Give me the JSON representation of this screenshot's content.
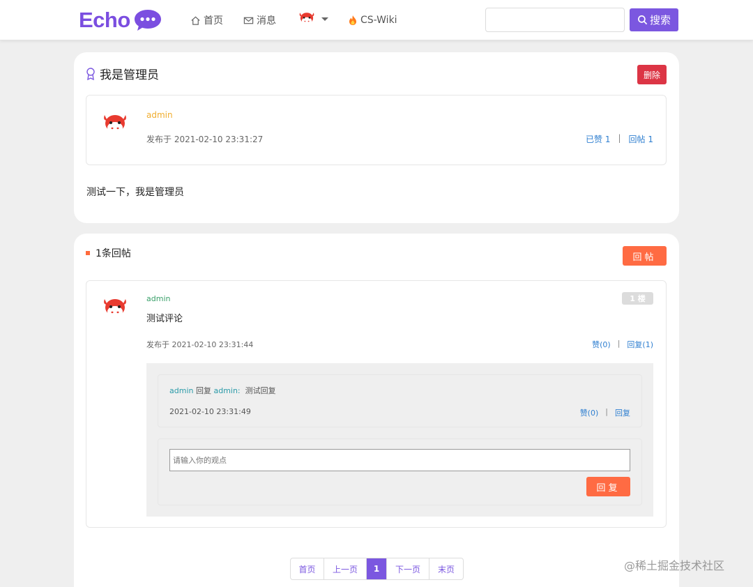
{
  "navbar": {
    "logo_text": "Echo",
    "home_label": "首页",
    "messages_label": "消息",
    "wiki_label": "CS-Wiki",
    "search_placeholder": "",
    "search_button": "搜索"
  },
  "post": {
    "title": "我是管理员",
    "delete_label": "删除",
    "author": "admin",
    "published": "发布于 2021-02-10 23:31:27",
    "liked_label": "已赞 1",
    "reply_count_label": "回帖 1",
    "content": "测试一下，我是管理员"
  },
  "replies": {
    "count_label": "1条回帖",
    "reply_button": "回帖",
    "items": [
      {
        "author": "admin",
        "floor": "1 楼",
        "content": "测试评论",
        "time": "发布于 2021-02-10 23:31:44",
        "like_label": "赞(0)",
        "reply_label": "回复(1)",
        "sub_replies": [
          {
            "from": "admin",
            "verb": "回复",
            "to": "admin:",
            "content": "测试回复",
            "time": "2021-02-10 23:31:49",
            "like_label": "赞(0)",
            "reply_label": "回复"
          }
        ],
        "comment_placeholder": "请输入你的观点",
        "comment_button": "回复"
      }
    ]
  },
  "pagination": {
    "first": "首页",
    "prev": "上一页",
    "current": "1",
    "next": "下一页",
    "last": "末页"
  },
  "watermark": "@稀土掘金技术社区",
  "colors": {
    "brand": "#7b57e0",
    "danger": "#dc3545",
    "accent": "#ff6b43",
    "link": "#2f7fd0"
  }
}
